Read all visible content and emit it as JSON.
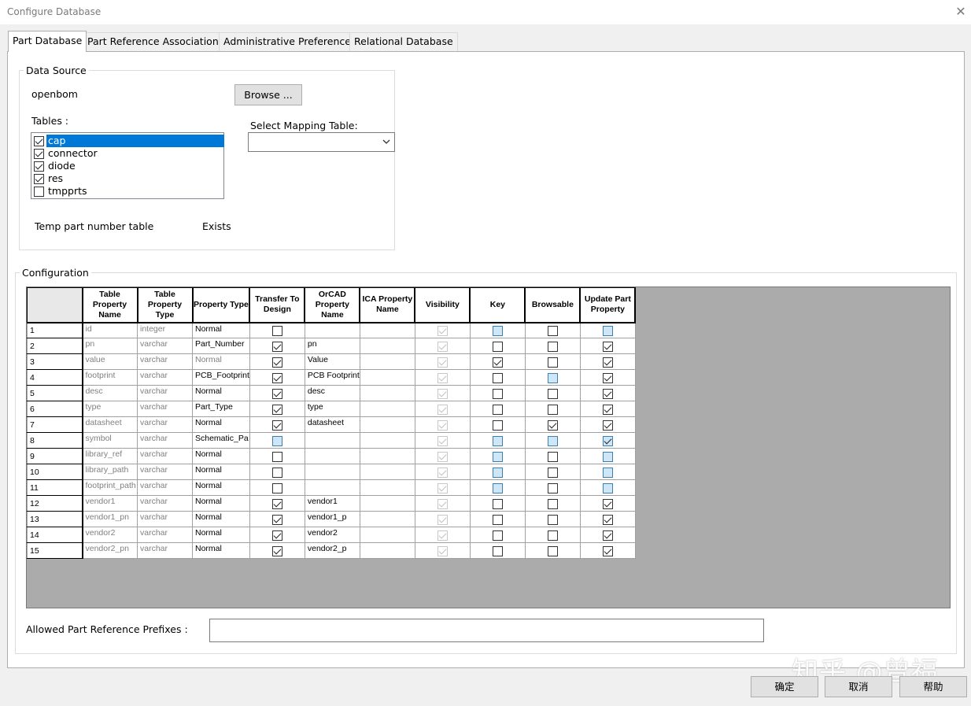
{
  "window": {
    "title": "Configure Database",
    "close_icon": "close-icon"
  },
  "tabs": [
    {
      "label": "Part Database",
      "active": true
    },
    {
      "label": "Part Reference Associations",
      "active": false
    },
    {
      "label": "Administrative Preferences",
      "active": false
    },
    {
      "label": "Relational Database",
      "active": false
    }
  ],
  "data_source": {
    "group_label": "Data Source",
    "source_name": "openbom",
    "browse_label": "Browse ...",
    "tables_label": "Tables :",
    "tables": [
      {
        "name": "cap",
        "checked": true,
        "selected": true
      },
      {
        "name": "connector",
        "checked": true,
        "selected": false
      },
      {
        "name": "diode",
        "checked": true,
        "selected": false
      },
      {
        "name": "res",
        "checked": true,
        "selected": false
      },
      {
        "name": "tmpprts",
        "checked": false,
        "selected": false
      }
    ],
    "mapping_label": "Select Mapping Table:",
    "mapping_value": "",
    "temp_label": "Temp part number table",
    "temp_status": "Exists"
  },
  "configuration": {
    "group_label": "Configuration",
    "columns": [
      "Table Property Name",
      "Table Property Type",
      "Property Type",
      "Transfer To Design",
      "OrCAD Property Name",
      "ICA Property Name",
      "Visibility",
      "Key",
      "Browsable",
      "Update Part Property"
    ],
    "rows": [
      {
        "num": "1",
        "name": "id",
        "type": "integer",
        "ptype": "Normal",
        "ptype_gray": false,
        "transfer": "off",
        "orcad": "",
        "ica": "",
        "visibility": "on",
        "key": "blue",
        "browsable": "off",
        "update": "blue"
      },
      {
        "num": "2",
        "name": "pn",
        "type": "varchar",
        "ptype": "Part_Number",
        "ptype_gray": false,
        "transfer": "on",
        "orcad": "pn",
        "ica": "",
        "visibility": "on",
        "key": "off",
        "browsable": "off",
        "update": "on"
      },
      {
        "num": "3",
        "name": "value",
        "type": "varchar",
        "ptype": "Normal",
        "ptype_gray": true,
        "transfer": "on",
        "orcad": "Value",
        "ica": "",
        "visibility": "on",
        "key": "on",
        "browsable": "off",
        "update": "on"
      },
      {
        "num": "4",
        "name": "footprint",
        "type": "varchar",
        "ptype": "PCB_Footprint",
        "ptype_gray": false,
        "transfer": "on",
        "orcad": "PCB Footprint",
        "ica": "",
        "visibility": "on",
        "key": "off",
        "browsable": "blue",
        "update": "on"
      },
      {
        "num": "5",
        "name": "desc",
        "type": "varchar",
        "ptype": "Normal",
        "ptype_gray": false,
        "transfer": "on",
        "orcad": "desc",
        "ica": "",
        "visibility": "on",
        "key": "off",
        "browsable": "off",
        "update": "on"
      },
      {
        "num": "6",
        "name": "type",
        "type": "varchar",
        "ptype": "Part_Type",
        "ptype_gray": false,
        "transfer": "on",
        "orcad": "type",
        "ica": "",
        "visibility": "on",
        "key": "off",
        "browsable": "off",
        "update": "on"
      },
      {
        "num": "7",
        "name": "datasheet",
        "type": "varchar",
        "ptype": "Normal",
        "ptype_gray": false,
        "transfer": "on",
        "orcad": "datasheet",
        "ica": "",
        "visibility": "on",
        "key": "off",
        "browsable": "on",
        "update": "on"
      },
      {
        "num": "8",
        "name": "symbol",
        "type": "varchar",
        "ptype": "Schematic_Pa",
        "ptype_gray": false,
        "transfer": "blue",
        "orcad": "",
        "ica": "",
        "visibility": "on",
        "key": "blue",
        "browsable": "blue",
        "update": "blueon"
      },
      {
        "num": "9",
        "name": "library_ref",
        "type": "varchar",
        "ptype": "Normal",
        "ptype_gray": false,
        "transfer": "off",
        "orcad": "",
        "ica": "",
        "visibility": "on",
        "key": "blue",
        "browsable": "off",
        "update": "blue"
      },
      {
        "num": "10",
        "name": "library_path",
        "type": "varchar",
        "ptype": "Normal",
        "ptype_gray": false,
        "transfer": "off",
        "orcad": "",
        "ica": "",
        "visibility": "on",
        "key": "blue",
        "browsable": "off",
        "update": "blue"
      },
      {
        "num": "11",
        "name": "footprint_path",
        "type": "varchar",
        "ptype": "Normal",
        "ptype_gray": false,
        "transfer": "off",
        "orcad": "",
        "ica": "",
        "visibility": "on",
        "key": "blue",
        "browsable": "off",
        "update": "blue"
      },
      {
        "num": "12",
        "name": "vendor1",
        "type": "varchar",
        "ptype": "Normal",
        "ptype_gray": false,
        "transfer": "on",
        "orcad": "vendor1",
        "ica": "",
        "visibility": "on",
        "key": "off",
        "browsable": "off",
        "update": "on"
      },
      {
        "num": "13",
        "name": "vendor1_pn",
        "type": "varchar",
        "ptype": "Normal",
        "ptype_gray": false,
        "transfer": "on",
        "orcad": "vendor1_p",
        "ica": "",
        "visibility": "on",
        "key": "off",
        "browsable": "off",
        "update": "on"
      },
      {
        "num": "14",
        "name": "vendor2",
        "type": "varchar",
        "ptype": "Normal",
        "ptype_gray": false,
        "transfer": "on",
        "orcad": "vendor2",
        "ica": "",
        "visibility": "on",
        "key": "off",
        "browsable": "off",
        "update": "on"
      },
      {
        "num": "15",
        "name": "vendor2_pn",
        "type": "varchar",
        "ptype": "Normal",
        "ptype_gray": false,
        "transfer": "on",
        "orcad": "vendor2_p",
        "ica": "",
        "visibility": "on",
        "key": "off",
        "browsable": "off",
        "update": "on"
      }
    ]
  },
  "prefixes": {
    "label": "Allowed Part Reference Prefixes :",
    "value": ""
  },
  "buttons": {
    "ok": "确定",
    "cancel": "取消",
    "help": "帮助"
  },
  "watermark": "知乎 @曾福",
  "colors": {
    "selection": "#0078d7",
    "key_highlight": "#cfe6f7",
    "grid_background": "#ababab"
  }
}
